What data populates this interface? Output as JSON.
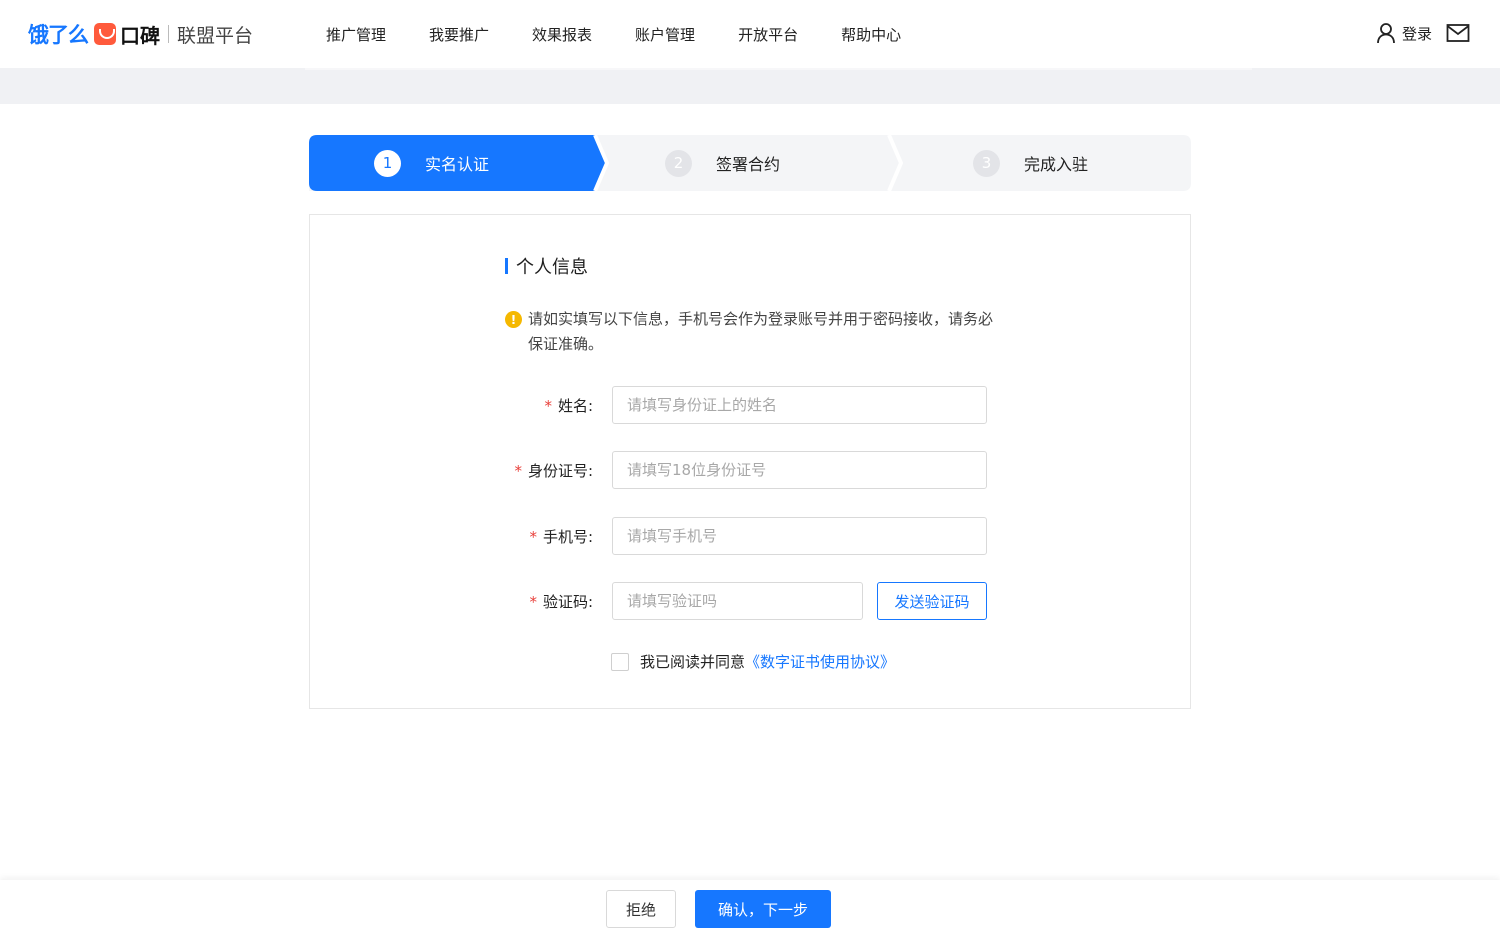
{
  "header": {
    "logo_ele": "饿了么",
    "logo_koubei": "口碑",
    "logo_platform": "联盟平台",
    "nav": [
      "推广管理",
      "我要推广",
      "效果报表",
      "账户管理",
      "开放平台",
      "帮助中心"
    ],
    "login_label": "登录"
  },
  "steps": [
    {
      "num": "1",
      "label": "实名认证",
      "active": true
    },
    {
      "num": "2",
      "label": "签署合约",
      "active": false
    },
    {
      "num": "3",
      "label": "完成入驻",
      "active": false
    }
  ],
  "form": {
    "section_title": "个人信息",
    "notice": "请如实填写以下信息，手机号会作为登录账号并用于密码接收，请务必保证准确。",
    "required_mark": "*",
    "fields": {
      "name": {
        "label": "姓名:",
        "placeholder": "请填写身份证上的姓名",
        "value": ""
      },
      "id_number": {
        "label": "身份证号:",
        "placeholder": "请填写18位身份证号",
        "value": ""
      },
      "phone": {
        "label": "手机号:",
        "placeholder": "请填写手机号",
        "value": ""
      },
      "code": {
        "label": "验证码:",
        "placeholder": "请填写验证吗",
        "value": ""
      }
    },
    "send_code_label": "发送验证码",
    "agree_text": "我已阅读并同意",
    "agree_link": "《数字证书使用协议》"
  },
  "footer": {
    "reject_label": "拒绝",
    "confirm_label": "确认，下一步"
  },
  "colors": {
    "primary": "#1677ff",
    "warning": "#f5b800",
    "required": "#e8403b"
  }
}
